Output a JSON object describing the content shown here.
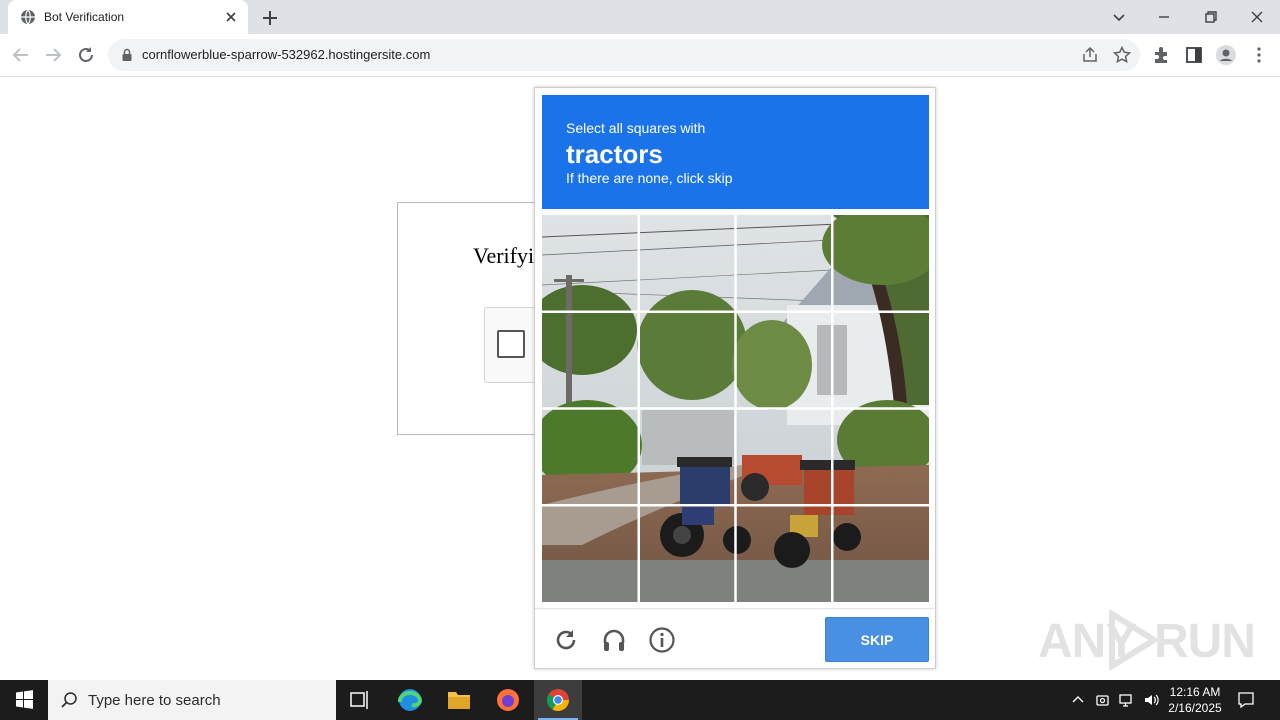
{
  "browser": {
    "tab": {
      "title": "Bot Verification",
      "favicon": "globe-icon"
    },
    "url": "cornflowerblue-sparrow-532962.hostingersite.com"
  },
  "page": {
    "title": "Verifyi"
  },
  "captcha": {
    "instruction": "Select all squares with",
    "object": "tractors",
    "hint": "If there are none, click skip",
    "grid_rows": 4,
    "grid_cols": 4,
    "skip_label": "SKIP",
    "footer_icons": [
      "reload-icon",
      "audio-icon",
      "info-icon"
    ],
    "header_color": "#1a73e8",
    "button_color": "#4a90e2"
  },
  "watermark": {
    "left": "ANY",
    "right": "RUN"
  },
  "taskbar": {
    "search_placeholder": "Type here to search",
    "time": "12:16 AM",
    "date": "2/16/2025",
    "apps": [
      "task-view-icon",
      "edge-icon",
      "file-explorer-icon",
      "firefox-icon",
      "chrome-icon"
    ]
  }
}
